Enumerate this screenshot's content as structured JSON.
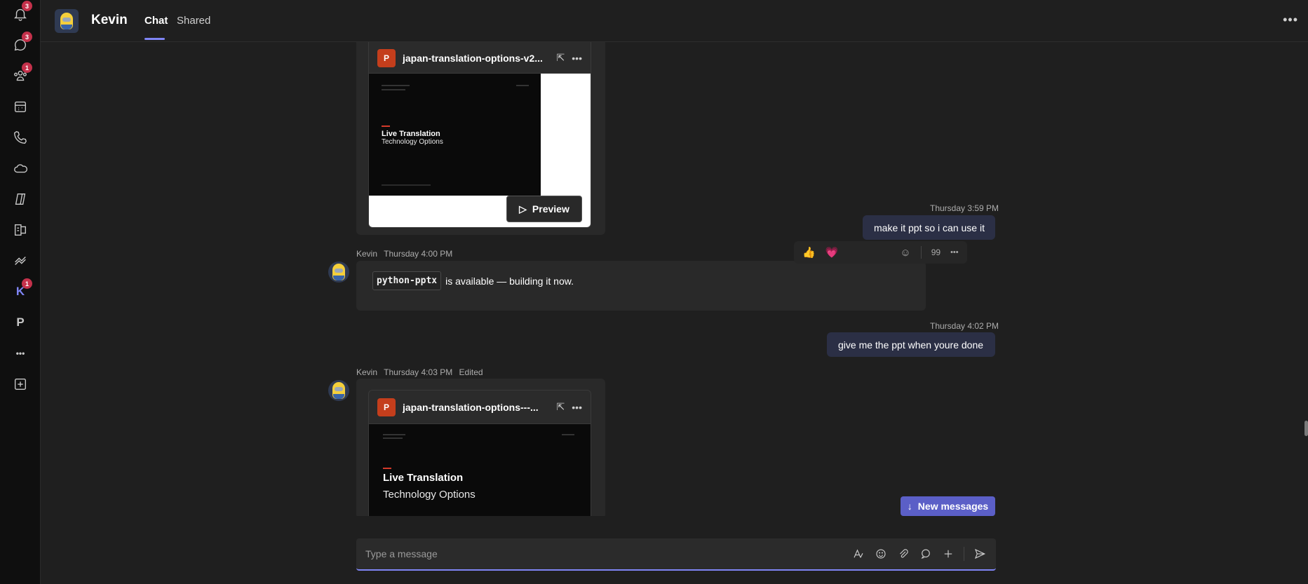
{
  "rail": {
    "items": [
      {
        "name": "activity",
        "badge": "3"
      },
      {
        "name": "chat",
        "badge": "3"
      },
      {
        "name": "teams",
        "badge": "1"
      },
      {
        "name": "calendar",
        "badge": ""
      },
      {
        "name": "calls",
        "badge": ""
      },
      {
        "name": "onedrive",
        "badge": ""
      },
      {
        "name": "copilot",
        "badge": ""
      },
      {
        "name": "apps",
        "badge": ""
      },
      {
        "name": "planner",
        "badge": ""
      },
      {
        "name": "k-app",
        "letter": "K",
        "badge": "1"
      },
      {
        "name": "p-app",
        "letter": "P",
        "badge": ""
      },
      {
        "name": "more-apps",
        "letter": "•••",
        "badge": ""
      },
      {
        "name": "add-app",
        "badge": ""
      }
    ]
  },
  "header": {
    "title": "Kevin",
    "tabs": [
      {
        "label": "Chat",
        "active": true
      },
      {
        "label": "Shared",
        "active": false
      }
    ],
    "more": "•••"
  },
  "messages": {
    "file1": {
      "name": "japan-translation-options-v2...",
      "slide_title": "Live Translation",
      "slide_subtitle": "Technology Options",
      "preview_label": "Preview"
    },
    "my1": {
      "time": "Thursday 3:59 PM",
      "text": "make it ppt so i can use it"
    },
    "kevin2": {
      "author": "Kevin",
      "time": "Thursday 4:00 PM",
      "code": "python-pptx",
      "text": "is available — building it now."
    },
    "reactions": {
      "like": "👍",
      "heart": "💗",
      "quote": "99",
      "more": "•••"
    },
    "my2": {
      "time": "Thursday 4:02 PM",
      "text": "give me the ppt when youre done"
    },
    "kevin3": {
      "author": "Kevin",
      "time": "Thursday 4:03 PM",
      "edited": "Edited",
      "file_name": "japan-translation-options---...",
      "slide_title": "Live Translation",
      "slide_subtitle": "Technology Options"
    },
    "new_messages": "New messages"
  },
  "composer": {
    "placeholder": "Type a message"
  },
  "colors": {
    "accent": "#7f85f5",
    "badge": "#c4314b",
    "ppt": "#c43e1c",
    "my_bubble": "#2b2f45"
  }
}
